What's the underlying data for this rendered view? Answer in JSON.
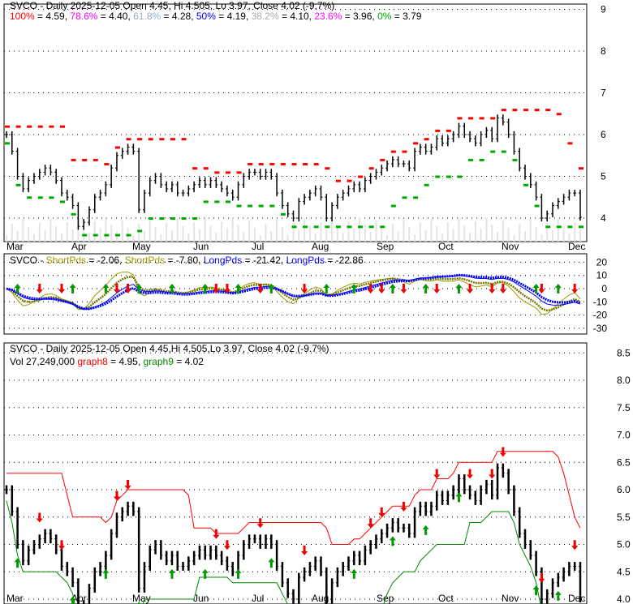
{
  "panel1": {
    "title": "SVCO - Daily 2025-12-05 Open 4.45, Hi 4.505, Lo 3.97, Close 4.02 (-9.7%)",
    "fib": [
      {
        "label": "100%",
        "value": "= 4.59,",
        "color": "#ff0000"
      },
      {
        "label": "78.6%",
        "value": "= 4.40,",
        "color": "#ff00ff"
      },
      {
        "label": "61.8%",
        "value": "= 4.28,",
        "color": "#99aacc"
      },
      {
        "label": "50%",
        "value": "= 4.19,",
        "color": "#0000ff"
      },
      {
        "label": "38.2%",
        "value": "= 4.10,",
        "color": "#aaaaaa"
      },
      {
        "label": "23.6%",
        "value": "= 3.96,",
        "color": "#ff00ff"
      },
      {
        "label": "0%",
        "value": "= 3.79",
        "color": "#00aa00"
      }
    ],
    "yticks": [
      "4",
      "5",
      "6",
      "7",
      "8",
      "9"
    ]
  },
  "panel2": {
    "prefix": "SVCO - ",
    "items": [
      {
        "label": "ShortPds",
        "value": "= -2.06,",
        "color": "#999900"
      },
      {
        "label": "ShortPds",
        "value": "= -7.80,",
        "color": "#999900"
      },
      {
        "label": "LongPds",
        "value": "= -21.42,",
        "color": "#0000ff"
      },
      {
        "label": "LongPds",
        "value": "= -22.86",
        "color": "#0000ff"
      }
    ],
    "yticks": [
      "20",
      "10",
      "0",
      "-10",
      "-20",
      "-30"
    ]
  },
  "panel3": {
    "title": "SVCO - Daily 2025-12-05 Open 4.45,Hi 4.505,Lo 3.97, Close 4.02 (-9.7%)",
    "vol": "Vol 27,249,000",
    "g8": "graph8",
    "g8v": "= 4.95,",
    "g9": "graph9",
    "g9v": "= 4.02",
    "yticks": [
      "4.0",
      "4.5",
      "5.0",
      "5.5",
      "6.0",
      "6.5",
      "7.0",
      "7.5",
      "8.0",
      "8.5"
    ]
  },
  "months": [
    "Mar",
    "Apr",
    "May",
    "Jun",
    "Jul",
    "Aug",
    "Sep",
    "Oct",
    "Nov",
    "Dec"
  ],
  "chart_data": {
    "type": "line",
    "title": "SVCO - Daily",
    "ylim": [
      3.5,
      9.2
    ],
    "close": [
      6.0,
      5.6,
      5.0,
      4.7,
      4.9,
      5.0,
      5.1,
      5.2,
      5.1,
      4.9,
      4.6,
      4.5,
      4.3,
      3.8,
      3.9,
      4.2,
      4.5,
      4.6,
      4.8,
      5.2,
      5.5,
      5.6,
      5.7,
      5.6,
      4.2,
      4.6,
      4.9,
      5.0,
      4.8,
      4.7,
      4.8,
      4.6,
      4.6,
      4.7,
      4.8,
      4.9,
      4.8,
      4.9,
      4.8,
      4.7,
      4.6,
      4.5,
      4.8,
      5.0,
      5.1,
      5.1,
      5.0,
      5.1,
      5.0,
      4.6,
      4.3,
      4.1,
      4.0,
      4.4,
      4.5,
      4.6,
      4.7,
      4.5,
      4.0,
      4.3,
      4.5,
      4.6,
      4.7,
      4.8,
      4.7,
      4.9,
      5.0,
      5.1,
      5.2,
      5.3,
      5.4,
      5.3,
      5.3,
      5.2,
      5.6,
      5.7,
      5.6,
      5.7,
      5.9,
      5.8,
      5.9,
      6.0,
      6.2,
      6.0,
      5.9,
      5.8,
      6.0,
      6.1,
      5.9,
      6.4,
      6.3,
      6.0,
      5.6,
      5.2,
      5.0,
      4.8,
      4.5,
      4.0,
      4.1,
      4.3,
      4.4,
      4.5,
      4.6,
      4.6,
      4.02
    ],
    "up_arrows": [
      2,
      12,
      18,
      24,
      30,
      36,
      42,
      48,
      58,
      63,
      70,
      76,
      82,
      96,
      100
    ],
    "down_arrows": [
      6,
      10,
      20,
      22,
      38,
      40,
      46,
      54,
      66,
      68,
      72,
      78,
      84,
      88,
      90,
      97,
      103
    ]
  }
}
